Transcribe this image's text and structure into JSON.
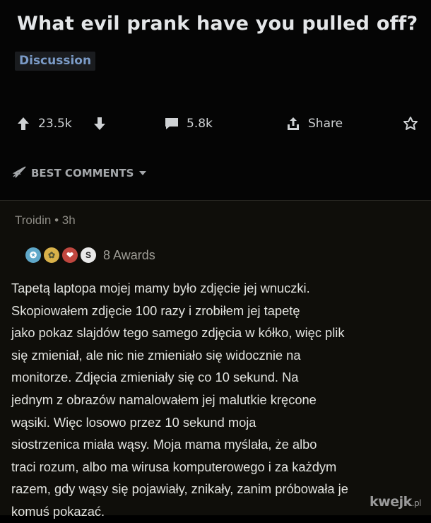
{
  "post": {
    "title": "What evil prank have you pulled off?",
    "flair": "Discussion",
    "upvotes": "23.5k",
    "comments": "5.8k",
    "share_label": "Share"
  },
  "sort": {
    "label": "BEST COMMENTS"
  },
  "comment": {
    "author": "Troidin",
    "time": "3h",
    "awards_label": "8 Awards",
    "lines": [
      "Tapetą laptopa mojej mamy było zdjęcie jej wnuczki.",
      "Skopiowałem zdjęcie 100 razy i zrobiłem jej tapetę",
      "jako pokaz slajdów tego samego zdjęcia w kółko, więc plik",
      "się zmieniał, ale nic nie zmieniało się widocznie na",
      "monitorze. Zdjęcia zmieniały się co 10 sekund. Na",
      "jednym z obrazów namalowałem jej malutkie kręcone",
      "wąsiki. Więc losowo przez 10 sekund moja",
      "siostrzenica miała wąsy. Moja mama myślała, że albo",
      "traci rozum, albo ma wirusa komputerowego i za każdym",
      "razem, gdy wąsy się pojawiały, znikały, zanim próbowała je",
      "komuś pokazać."
    ]
  },
  "watermark": {
    "main": "kwejk",
    "suffix": ".pl"
  },
  "icons": [
    "upvote-icon",
    "downvote-icon",
    "comment-icon",
    "share-icon",
    "award-icon",
    "sort-rocket-icon",
    "chevron-down-icon"
  ],
  "colors": {
    "flair_text": "#7b9bc7",
    "background": "#000000",
    "comment_background": "#0f0e0a"
  }
}
